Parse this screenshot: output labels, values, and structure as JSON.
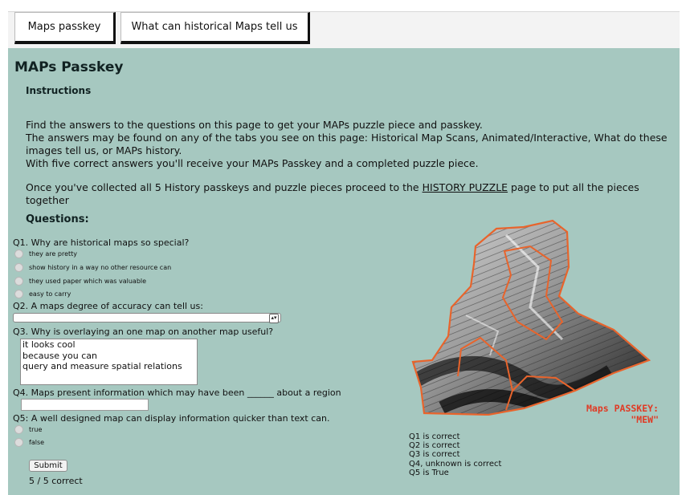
{
  "tabs": [
    {
      "label": "Maps passkey"
    },
    {
      "label": "What can historical Maps tell us"
    }
  ],
  "page": {
    "title": "MAPs Passkey",
    "instructions_heading": "Instructions",
    "instructions": [
      "Find the answers to the questions on this page to get your MAPs puzzle piece and passkey.",
      "The answers may be found on any of the tabs you see on this page: Historical Map Scans, Animated/Interactive, What do these images tell us, or MAPs history.",
      "With five correct answers you'll receive your MAPs Passkey and a completed puzzle piece."
    ],
    "collect_text_before": "Once you've collected all 5 History passkeys and puzzle pieces proceed to the ",
    "collect_link": "HISTORY PUZZLE",
    "collect_text_after": " page to put all the pieces together",
    "questions_heading": "Questions:"
  },
  "questions": {
    "q1": {
      "text": "Q1. Why are historical maps so special?",
      "options": [
        "they are pretty",
        "show history in a way no other resource can",
        "they used paper which was valuable",
        "easy to carry"
      ]
    },
    "q2": {
      "text": "Q2. A maps degree of accuracy can tell us:",
      "selected": ""
    },
    "q3": {
      "text": "Q3. Why is overlaying an one map on another map useful?",
      "options": [
        "it looks cool",
        "because you can",
        "query and measure spatial relations"
      ]
    },
    "q4": {
      "text": "Q4. Maps present information which may have been ______ about a region",
      "value": ""
    },
    "q5": {
      "text": "Q5: A well designed map can display information quicker than text can.",
      "options": [
        "true",
        "false"
      ]
    }
  },
  "submit_label": "Submit",
  "score": "5 / 5 correct",
  "passkey": {
    "line1": "Maps PASSKEY:",
    "line2": "\"MEW\""
  },
  "results": [
    "Q1 is correct",
    "Q2 is correct",
    "Q3 is correct",
    "Q4, unknown is correct",
    "Q5 is True"
  ],
  "colors": {
    "panel": "#a6c8c0",
    "passkey": "#e03a24",
    "puzzle_outline": "#e8642c"
  }
}
